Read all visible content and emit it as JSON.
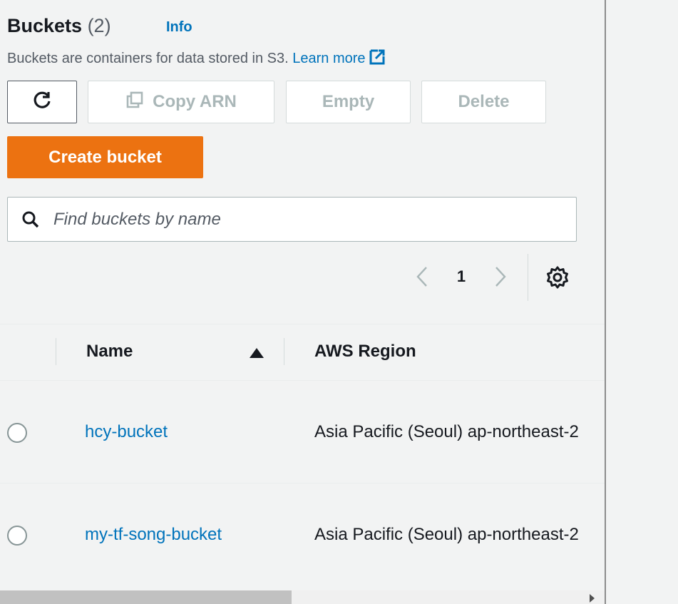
{
  "header": {
    "title": "Buckets",
    "count": "(2)",
    "info_label": "Info",
    "description": "Buckets are containers for data stored in S3.",
    "learn_more": "Learn more"
  },
  "toolbar": {
    "copy_arn_label": "Copy ARN",
    "empty_label": "Empty",
    "delete_label": "Delete",
    "create_label": "Create bucket"
  },
  "search": {
    "placeholder": "Find buckets by name",
    "value": ""
  },
  "pagination": {
    "current_page": "1"
  },
  "table": {
    "columns": [
      {
        "label": "Name",
        "sort": "ascending"
      },
      {
        "label": "AWS Region"
      }
    ],
    "rows": [
      {
        "name": "hcy-bucket",
        "region": "Asia Pacific (Seoul) ap-northeast-2",
        "selected": false
      },
      {
        "name": "my-tf-song-bucket",
        "region": "Asia Pacific (Seoul) ap-northeast-2",
        "selected": false
      }
    ]
  },
  "icons": {
    "refresh": "refresh-icon",
    "copy": "copy-icon",
    "external": "external-link-icon",
    "search": "search-icon",
    "prev": "chevron-left-icon",
    "next": "chevron-right-icon",
    "settings": "gear-icon",
    "sort": "sort-ascending-icon"
  },
  "colors": {
    "primary_button": "#ec7211",
    "link": "#0073bb",
    "text": "#16191f",
    "disabled_text": "#aab7b8"
  }
}
